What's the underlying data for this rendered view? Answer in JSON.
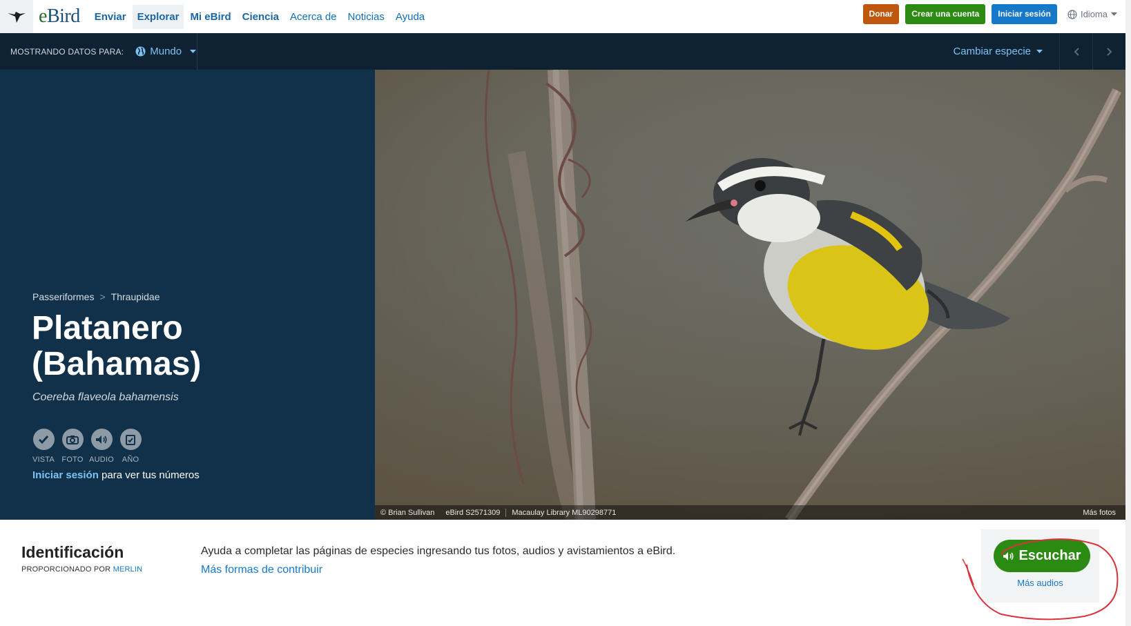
{
  "nav": {
    "logo_text_e": "e",
    "logo_text_bird": "Bird",
    "links": [
      "Enviar",
      "Explorar",
      "Mi eBird",
      "Ciencia",
      "Acerca de",
      "Noticias",
      "Ayuda"
    ],
    "donate": "Donar",
    "create_account": "Crear una cuenta",
    "sign_in": "Iniciar sesión",
    "language": "Idioma"
  },
  "databar": {
    "label": "MOSTRANDO DATOS PARA:",
    "region": "Mundo",
    "change_species": "Cambiar especie"
  },
  "species": {
    "order": "Passeriformes",
    "separator": ">",
    "family": "Thraupidae",
    "common_name": "Platanero (Bahamas)",
    "scientific_name": "Coereba flaveola bahamensis",
    "stats": [
      "VISTA",
      "FOTO",
      "AUDIO",
      "AÑO"
    ],
    "signin_link": "Iniciar sesión",
    "signin_suffix": " para ver tus números"
  },
  "photo": {
    "credit": "© Brian Sullivan",
    "checklist": "eBird S2571309",
    "asset": "Macaulay Library ML90298771",
    "more_photos": "Más fotos"
  },
  "identification": {
    "title": "Identificación",
    "provided_by": "PROPORCIONADO POR ",
    "provider": "MERLIN",
    "text": "Ayuda a completar las páginas de especies ingresando tus fotos, audios y avistamientos a eBird.",
    "link": "Más formas de contribuir",
    "listen": "Escuchar",
    "more_audio": "Más audios"
  },
  "colors": {
    "nav_blue": "#1578c9",
    "dark_bar": "#0f2233",
    "hero_panel": "#11314a",
    "green": "#2a8a12",
    "donate_orange": "#c0570f",
    "annotation_red": "#d9323a"
  }
}
